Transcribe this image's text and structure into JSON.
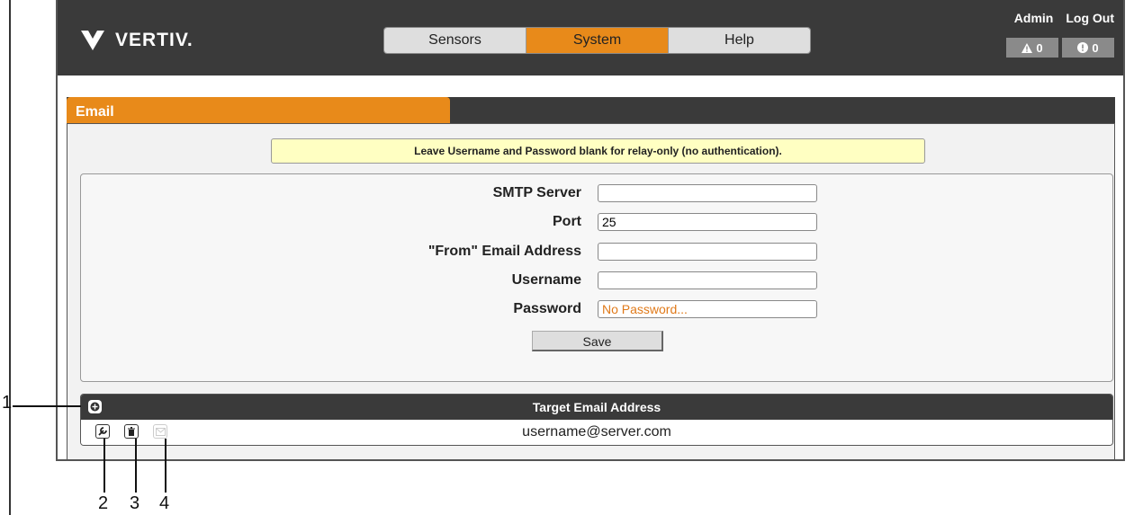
{
  "header": {
    "brand": "VERTIV.",
    "nav_tabs": [
      "Sensors",
      "System",
      "Help"
    ],
    "active_tab": "System",
    "admin_label": "Admin",
    "logout_label": "Log Out",
    "alarm_count": "0",
    "warning_count": "0"
  },
  "panel": {
    "title": "Email",
    "notice": "Leave Username and Password blank for relay-only (no authentication).",
    "fields": {
      "smtp_label": "SMTP Server",
      "smtp_value": "",
      "port_label": "Port",
      "port_value": "25",
      "from_label": "\"From\" Email Address",
      "from_value": "",
      "username_label": "Username",
      "username_value": "",
      "password_label": "Password",
      "password_placeholder": "No Password..."
    },
    "save_label": "Save"
  },
  "targets": {
    "header": "Target Email Address",
    "rows": [
      {
        "email": "username@server.com"
      }
    ]
  },
  "callouts": [
    "1",
    "2",
    "3",
    "4"
  ],
  "colors": {
    "accent": "#e88a1a",
    "topbar": "#3a3a3a",
    "notice_bg": "#ffffc2"
  },
  "icons": [
    "vertiv-logo-icon",
    "alarm-icon",
    "warning-icon",
    "add-icon",
    "wrench-icon",
    "trash-icon",
    "mail-icon"
  ]
}
